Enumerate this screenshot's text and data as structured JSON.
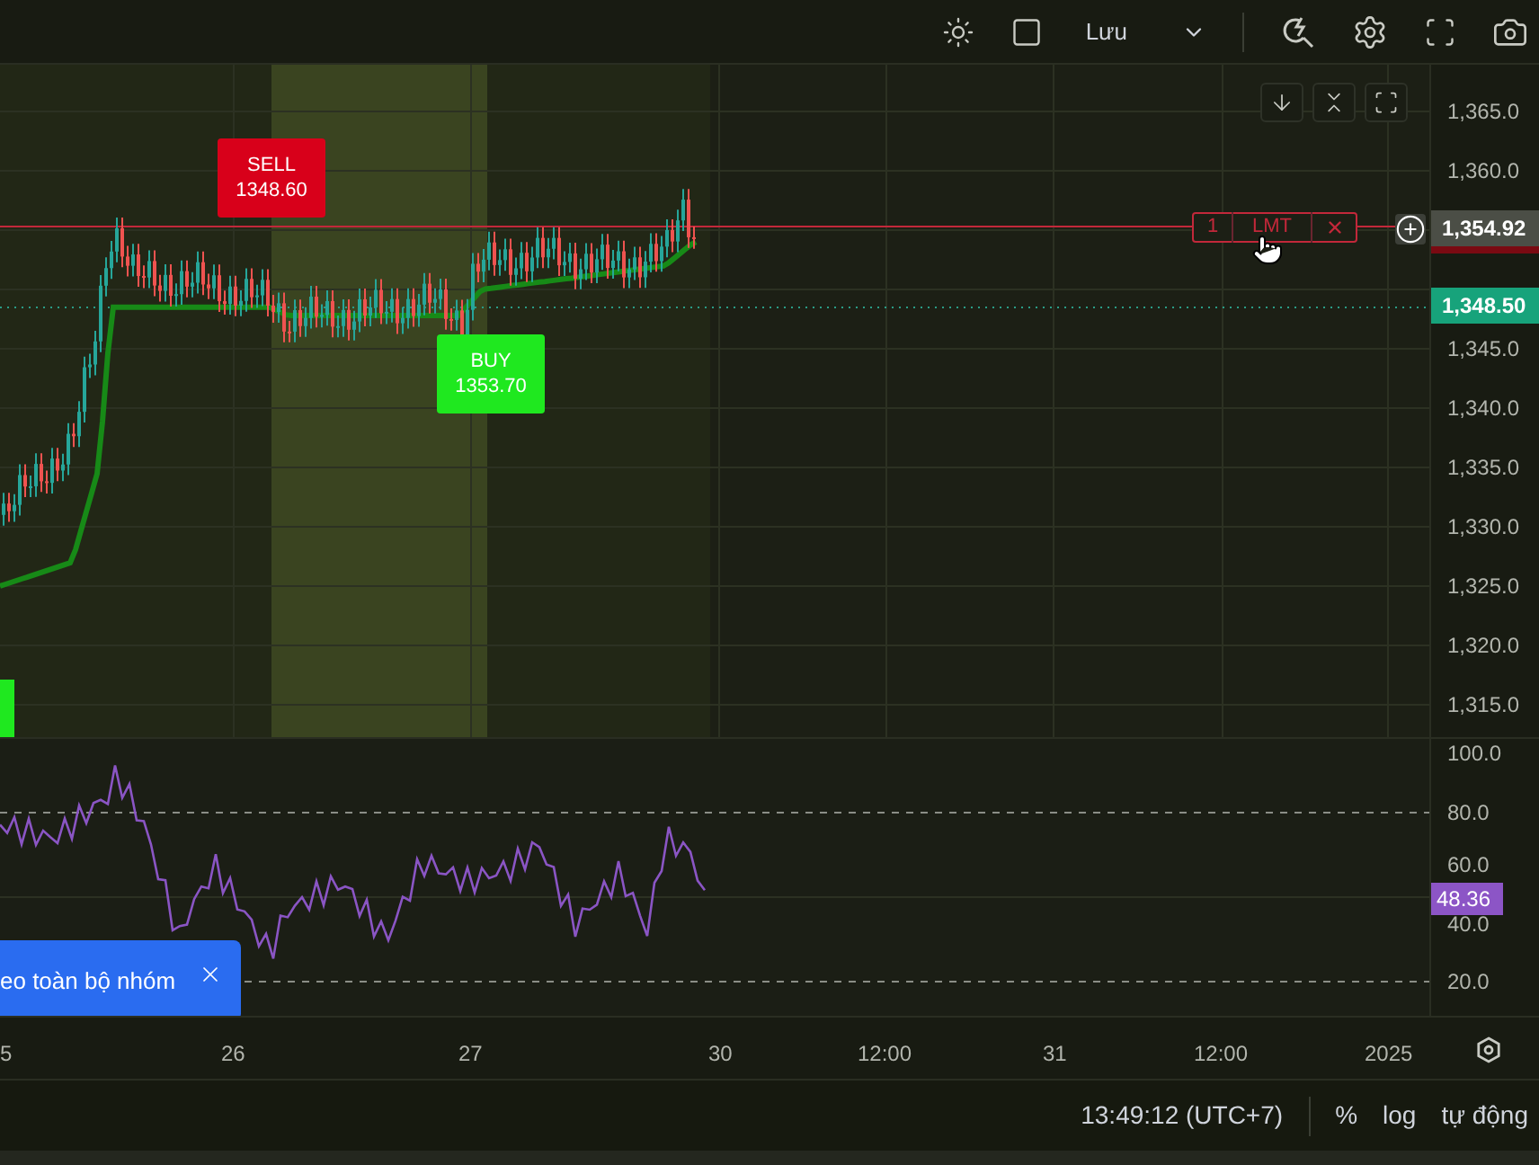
{
  "toolbar": {
    "layout_label": "Lưu"
  },
  "chart": {
    "markers": [
      {
        "kind": "sell",
        "label": "SELL",
        "price": "1348.60"
      },
      {
        "kind": "buy",
        "label": "BUY",
        "price": "1353.70"
      }
    ],
    "order": {
      "quantity": "1",
      "type": "LMT"
    },
    "price_axis": {
      "ticks": [
        "1,365.0",
        "1,360.0",
        "1,345.0",
        "1,340.0",
        "1,335.0",
        "1,330.0",
        "1,325.0",
        "1,320.0",
        "1,315.0"
      ],
      "tags": [
        {
          "label": "1,354.92",
          "color": "#4b4e46"
        },
        {
          "label": "1,348.50",
          "color": "#17a37b"
        }
      ]
    }
  },
  "rsi": {
    "ticks": [
      "100.0",
      "80.0",
      "60.0",
      "40.0",
      "20.0"
    ],
    "value_tag": {
      "label": "48.36",
      "color": "#8c55c6"
    }
  },
  "notification": {
    "text": "eo toàn bộ nhóm"
  },
  "time_axis": [
    "5",
    "26",
    "27",
    "30",
    "12:00",
    "31",
    "12:00",
    "2025"
  ],
  "status_bar": {
    "time": "13:49:12 (UTC+7)",
    "items": [
      "%",
      "log",
      "tự động"
    ]
  }
}
